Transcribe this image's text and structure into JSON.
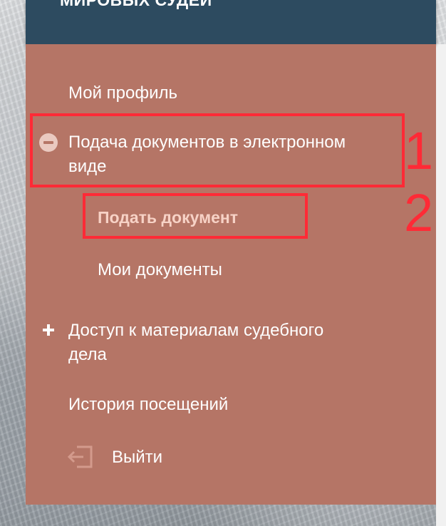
{
  "header": {
    "title": "МИРОВЫХ СУДЕЙ"
  },
  "menu": {
    "profile": "Мой профиль",
    "submit_docs": {
      "line1": "Подача документов в электронном",
      "line2": "виде"
    },
    "submit_doc": "Подать документ",
    "my_docs": "Мои документы",
    "case_access": {
      "line1": "Доступ к материалам судебного",
      "line2": "дела"
    },
    "history": "История посещений",
    "logout": "Выйти"
  },
  "annotations": {
    "box1": "1",
    "box2": "2"
  },
  "colors": {
    "header_bg": "#2d4b60",
    "panel_bg": "#b57566",
    "active_text": "#f7d2c6",
    "annotation": "#ff2a36"
  },
  "icons": [
    "minus-circle-icon",
    "plus-icon",
    "logout-icon"
  ]
}
